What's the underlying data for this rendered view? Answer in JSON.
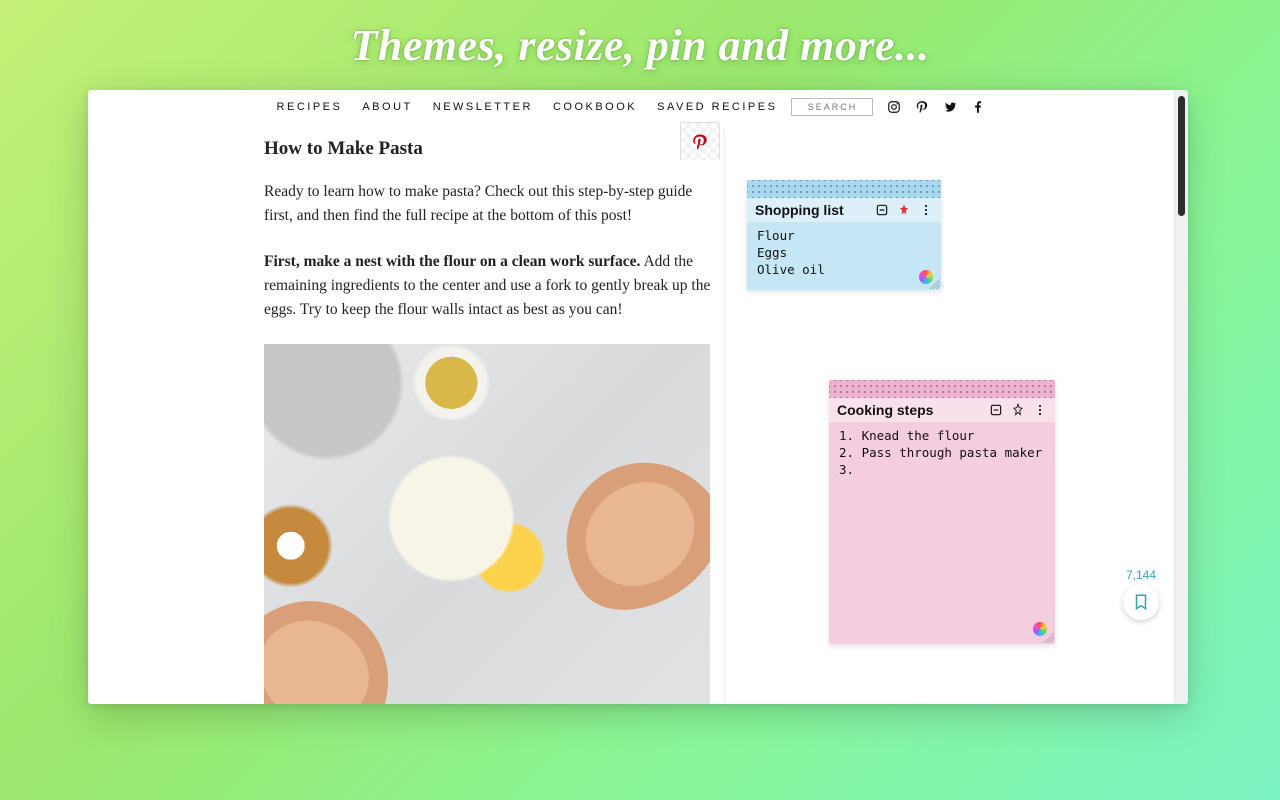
{
  "hero": "Themes, resize, pin and more...",
  "nav": {
    "items": [
      "RECIPES",
      "ABOUT",
      "NEWSLETTER",
      "COOKBOOK",
      "SAVED RECIPES"
    ],
    "search_placeholder": "SEARCH"
  },
  "article": {
    "title": "How to Make Pasta",
    "p1": "Ready to learn how to make pasta? Check out this step-by-step guide first, and then find the full recipe at the bottom of this post!",
    "p2_bold": "First, make a nest with the flour on a clean work surface.",
    "p2_rest": " Add the remaining ingredients to the center and use a fork to gently break up the eggs. Try to keep the flour walls intact as best as you can!"
  },
  "notes": {
    "shopping": {
      "title": "Shopping list",
      "body": "Flour\nEggs\nOlive oil",
      "pinned": true
    },
    "cooking": {
      "title": "Cooking steps",
      "body": "1. Knead the flour\n2. Pass through pasta maker\n3. ",
      "pinned": false
    }
  },
  "save": {
    "count": "7,144"
  }
}
